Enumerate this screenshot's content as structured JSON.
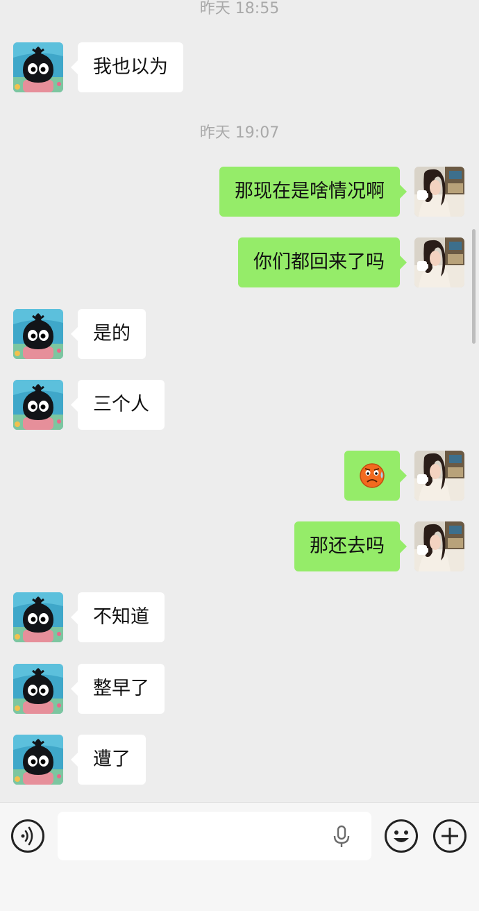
{
  "chat": {
    "timestamps": [
      "昨天 18:55",
      "昨天 19:07"
    ],
    "messages": [
      {
        "side": "left",
        "text": "我也以为"
      },
      {
        "side": "right",
        "text": "那现在是啥情况啊"
      },
      {
        "side": "right",
        "text": "你们都回来了吗"
      },
      {
        "side": "left",
        "text": "是的"
      },
      {
        "side": "left",
        "text": "三个人"
      },
      {
        "side": "right",
        "text": "",
        "emoji": "distressed-face-emoji"
      },
      {
        "side": "right",
        "text": "那还去吗"
      },
      {
        "side": "left",
        "text": "不知道"
      },
      {
        "side": "left",
        "text": "整早了"
      },
      {
        "side": "left",
        "text": "遭了"
      }
    ]
  },
  "input_bar": {
    "voice_icon": "voice-mode-icon",
    "mic_icon": "microphone-icon",
    "emoji_icon": "emoji-smile-icon",
    "plus_icon": "plus-icon",
    "text_value": ""
  },
  "colors": {
    "background": "#ededed",
    "sent_bubble": "#95ec69",
    "received_bubble": "#ffffff",
    "timestamp": "#a9a9a9"
  }
}
